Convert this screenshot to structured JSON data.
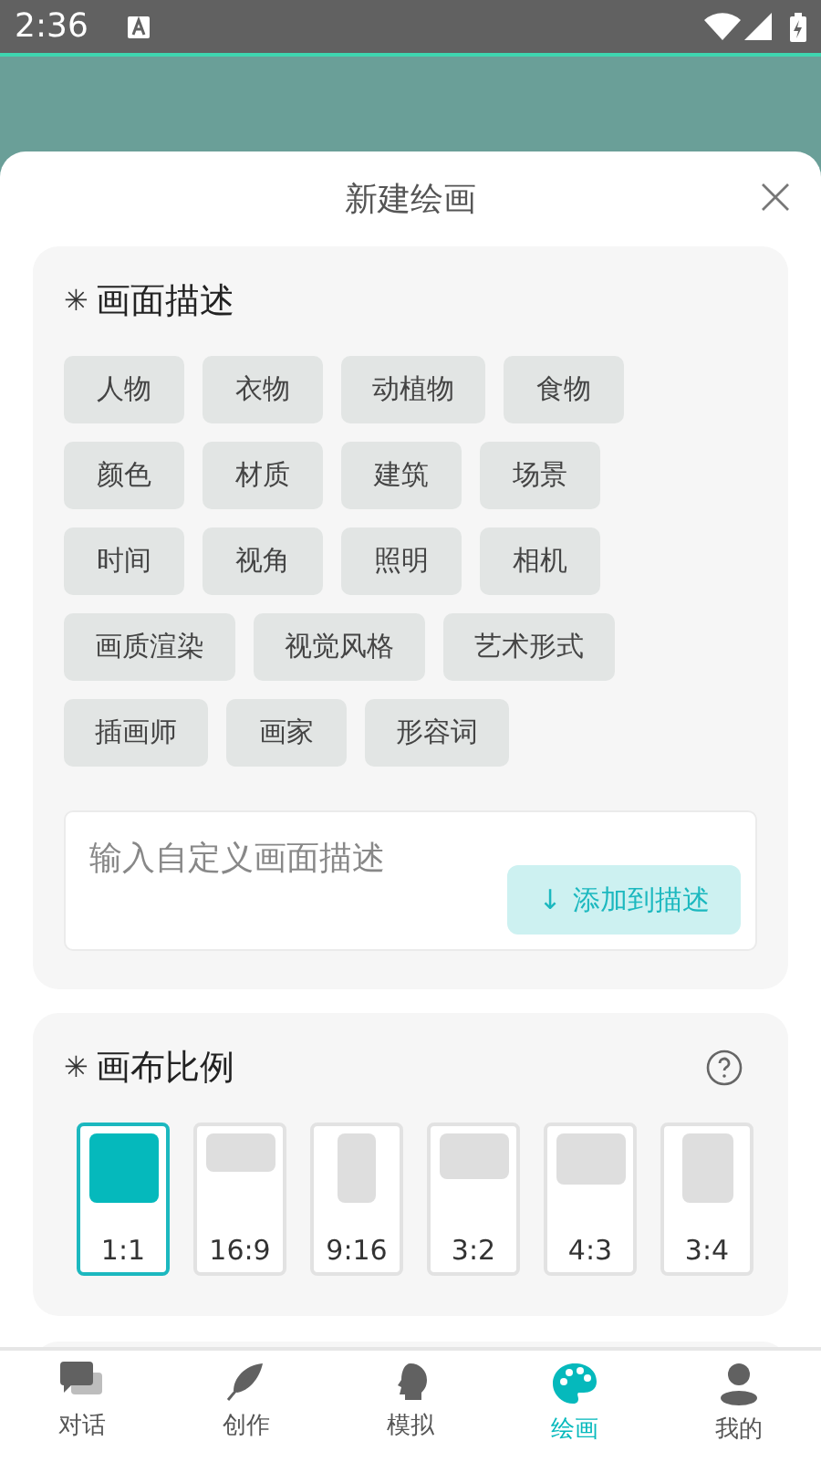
{
  "status_bar": {
    "time": "2:36"
  },
  "sheet": {
    "title": "新建绘画"
  },
  "description": {
    "marker": "✳",
    "title": "画面描述",
    "tag_rows": [
      [
        "人物",
        "衣物",
        "动植物",
        "食物"
      ],
      [
        "颜色",
        "材质",
        "建筑",
        "场景"
      ],
      [
        "时间",
        "视角",
        "照明",
        "相机"
      ],
      [
        "画质渲染",
        "视觉风格",
        "艺术形式"
      ],
      [
        "插画师",
        "画家",
        "形容词"
      ]
    ],
    "input": {
      "placeholder": "输入自定义画面描述"
    },
    "add_button": {
      "arrow": "↓",
      "label": "添加到描述"
    }
  },
  "ratio": {
    "marker": "✳",
    "title": "画布比例",
    "options": [
      {
        "label": "1:1",
        "selected": true
      },
      {
        "label": "16:9",
        "selected": false
      },
      {
        "label": "9:16",
        "selected": false
      },
      {
        "label": "3:2",
        "selected": false
      },
      {
        "label": "4:3",
        "selected": false
      },
      {
        "label": "3:4",
        "selected": false
      }
    ]
  },
  "nav": [
    {
      "label": "对话",
      "selected": false
    },
    {
      "label": "创作",
      "selected": false
    },
    {
      "label": "模拟",
      "selected": false
    },
    {
      "label": "绘画",
      "selected": true
    },
    {
      "label": "我的",
      "selected": false
    }
  ]
}
